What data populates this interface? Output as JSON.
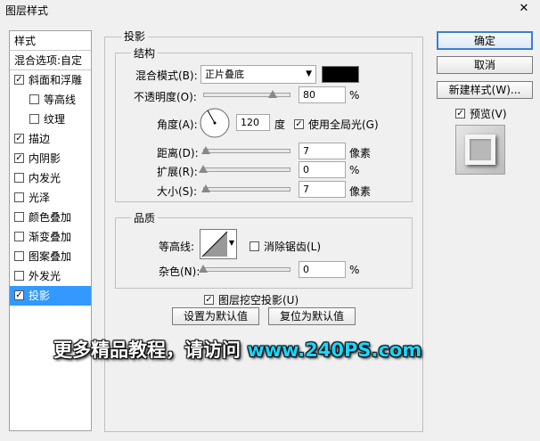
{
  "window": {
    "title": "图层样式",
    "close": "✕"
  },
  "left_panel": {
    "header": "样式",
    "blend_options": "混合选项:自定",
    "items": [
      {
        "label": "斜面和浮雕",
        "checked": true,
        "indent": false
      },
      {
        "label": "等高线",
        "checked": false,
        "indent": true
      },
      {
        "label": "纹理",
        "checked": false,
        "indent": true
      },
      {
        "label": "描边",
        "checked": true,
        "indent": false
      },
      {
        "label": "内阴影",
        "checked": true,
        "indent": false
      },
      {
        "label": "内发光",
        "checked": false,
        "indent": false
      },
      {
        "label": "光泽",
        "checked": false,
        "indent": false
      },
      {
        "label": "颜色叠加",
        "checked": false,
        "indent": false
      },
      {
        "label": "渐变叠加",
        "checked": false,
        "indent": false
      },
      {
        "label": "图案叠加",
        "checked": false,
        "indent": false
      },
      {
        "label": "外发光",
        "checked": false,
        "indent": false
      },
      {
        "label": "投影",
        "checked": true,
        "indent": false,
        "selected": true
      }
    ]
  },
  "shadow": {
    "title": "投影",
    "structure": {
      "title": "结构",
      "blend_mode_label": "混合模式(B):",
      "blend_mode_value": "正片叠底",
      "blend_color": "#000000",
      "opacity_label": "不透明度(O):",
      "opacity_value": "80",
      "opacity_fraction": 0.8,
      "percent": "%",
      "angle_label": "角度(A):",
      "angle_value": "120",
      "angle_unit": "度",
      "global_light_label": "使用全局光(G)",
      "global_light_checked": true,
      "distance_label": "距离(D):",
      "distance_value": "7",
      "distance_fraction": 0.03,
      "distance_unit": "像素",
      "spread_label": "扩展(R):",
      "spread_value": "0",
      "spread_fraction": 0,
      "size_label": "大小(S):",
      "size_value": "7",
      "size_fraction": 0.03,
      "size_unit": "像素"
    },
    "quality": {
      "title": "品质",
      "contour_label": "等高线:",
      "antialias_label": "消除锯齿(L)",
      "antialias_checked": false,
      "noise_label": "杂色(N):",
      "noise_value": "0",
      "noise_fraction": 0
    },
    "knockout_label": "图层挖空投影(U)",
    "knockout_checked": true,
    "make_default": "设置为默认值",
    "reset_default": "复位为默认值"
  },
  "buttons": {
    "ok": "确定",
    "cancel": "取消",
    "new_style": "新建样式(W)...",
    "preview_label": "预览(V)",
    "preview_checked": true
  },
  "watermark": {
    "text": "更多精品教程，请访问",
    "url": "www.240PS.com"
  },
  "colors": {
    "selection": "#3399ff",
    "accent": "#3c7fd1",
    "watermark_url": "#19d6ff"
  }
}
